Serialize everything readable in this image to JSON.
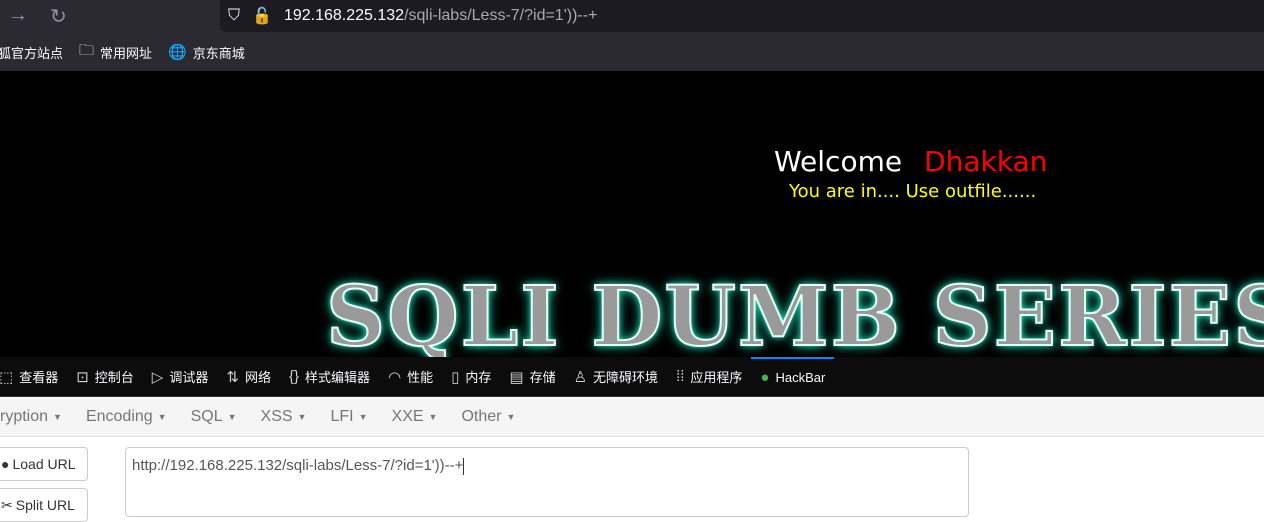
{
  "browser": {
    "url_host": "192.168.225.132",
    "url_path": "/sqli-labs/Less-7/?id=1'))--+",
    "bookmarks": [
      {
        "label": "狐官方站点",
        "icon": "firefox-icon"
      },
      {
        "label": "常用网址",
        "icon": "folder-icon"
      },
      {
        "label": "京东商城",
        "icon": "globe-icon"
      }
    ]
  },
  "page": {
    "welcome": "Welcome",
    "name": "Dhakkan",
    "message": "You are in.... Use outfile......",
    "logo_text": "SQLI DUMB SERIES"
  },
  "devtools": {
    "tabs": [
      {
        "label": "查看器",
        "icon": "inspector-icon"
      },
      {
        "label": "控制台",
        "icon": "console-icon"
      },
      {
        "label": "调试器",
        "icon": "debugger-icon"
      },
      {
        "label": "网络",
        "icon": "network-icon"
      },
      {
        "label": "样式编辑器",
        "icon": "style-editor-icon"
      },
      {
        "label": "性能",
        "icon": "performance-icon"
      },
      {
        "label": "内存",
        "icon": "memory-icon"
      },
      {
        "label": "存储",
        "icon": "storage-icon"
      },
      {
        "label": "无障碍环境",
        "icon": "accessibility-icon"
      },
      {
        "label": "应用程序",
        "icon": "application-icon"
      },
      {
        "label": "HackBar",
        "icon": "hackbar-icon"
      }
    ]
  },
  "hackbar": {
    "menus": [
      "ryption",
      "Encoding",
      "SQL",
      "XSS",
      "LFI",
      "XXE",
      "Other"
    ],
    "load_url": "Load URL",
    "split_url": "Split URL",
    "url_value": "http://192.168.225.132/sqli-labs/Less-7/?id=1'))--+"
  }
}
